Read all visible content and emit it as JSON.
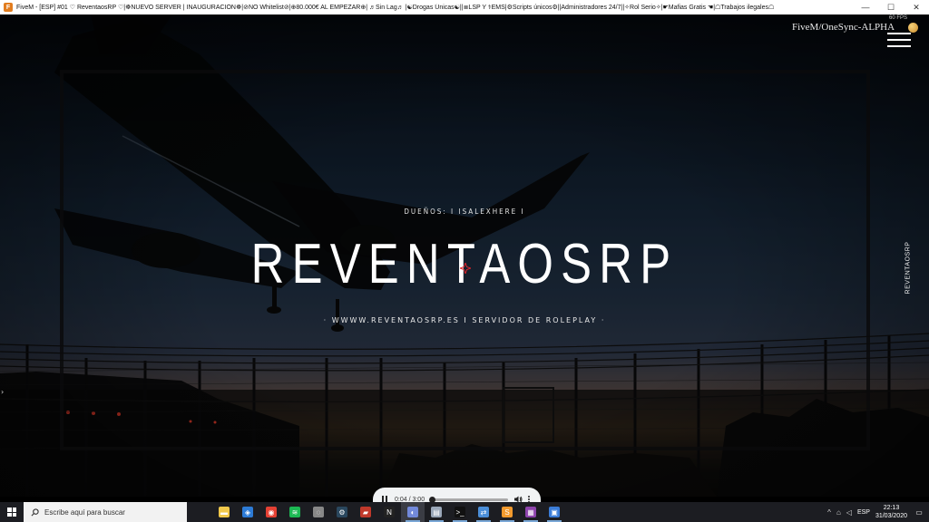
{
  "window": {
    "title": "FiveM - [ESP] #01 ♡ ReventaosRP ♡|☸NUEVO SERVER | INAUGURACIÓN☸|⊘NO Whitelist⊘|⊕80.000€ AL EMPEZAR⊕| ♬Sin Lag♬ |☯Drogas Únicas☯||≣LSP Y ⚕EMS|⚙Scripts únicos⚙||Administradores 24/7||✧Rol Serio✧|☛Mafias Gratis ☚|☖Trabajos ilegales☖",
    "app_icon": "fivem-icon",
    "controls": {
      "minimize": "—",
      "maximize": "☐",
      "close": "✕"
    }
  },
  "loading_screen": {
    "owners": "DUEÑOS: I ISALEXHERE I",
    "title": "REVENTAOSRP",
    "subtitle": "· WWWW.REVENTAOSRP.ES I SERVIDOR DE ROLEPLAY ·",
    "side_brand": "REVENTAOSRP",
    "fps": "60 FPS",
    "build": "FiveM/OneSync-ALPHA",
    "left_arrow": "›",
    "accent_color": "#ffffff",
    "logo_color": "#e0242b"
  },
  "audio_player": {
    "time": "0:04 / 3:00",
    "progress": 0.022,
    "state": "playing"
  },
  "taskbar": {
    "search_placeholder": "Escribe aquí para buscar",
    "apps": [
      {
        "name": "file-explorer-icon",
        "color": "#f2c94c",
        "glyph": "▬",
        "running": false
      },
      {
        "name": "store-icon",
        "color": "#2d7bd6",
        "glyph": "◈",
        "running": false
      },
      {
        "name": "chrome-icon",
        "color": "#e44134",
        "glyph": "◉",
        "running": false
      },
      {
        "name": "spotify-icon",
        "color": "#1db954",
        "glyph": "≋",
        "running": false
      },
      {
        "name": "ubisoft-icon",
        "color": "#888888",
        "glyph": "◌",
        "running": false
      },
      {
        "name": "steam-icon",
        "color": "#2a475e",
        "glyph": "⚙",
        "running": false
      },
      {
        "name": "app-red-icon",
        "color": "#c0392b",
        "glyph": "▰",
        "running": false
      },
      {
        "name": "nvidia-icon",
        "color": "#222222",
        "glyph": "N",
        "running": false
      },
      {
        "name": "discord-icon",
        "color": "#7289da",
        "glyph": "◐",
        "running": true,
        "active": true
      },
      {
        "name": "window-app-icon",
        "color": "#9aa7b8",
        "glyph": "▤",
        "running": true
      },
      {
        "name": "terminal-icon",
        "color": "#111111",
        "glyph": ">_",
        "running": true
      },
      {
        "name": "network-app-icon",
        "color": "#4b8ed8",
        "glyph": "⇄",
        "running": true
      },
      {
        "name": "sublime-icon",
        "color": "#f29a2e",
        "glyph": "S",
        "running": true
      },
      {
        "name": "winrar-icon",
        "color": "#8e44ad",
        "glyph": "▦",
        "running": true
      },
      {
        "name": "fivem-taskbar-icon",
        "color": "#3b7dd8",
        "glyph": "▣",
        "running": true
      }
    ],
    "tray": {
      "chevron": "^",
      "lang": "ESP",
      "time": "22:13",
      "date": "31/03/2020"
    }
  }
}
